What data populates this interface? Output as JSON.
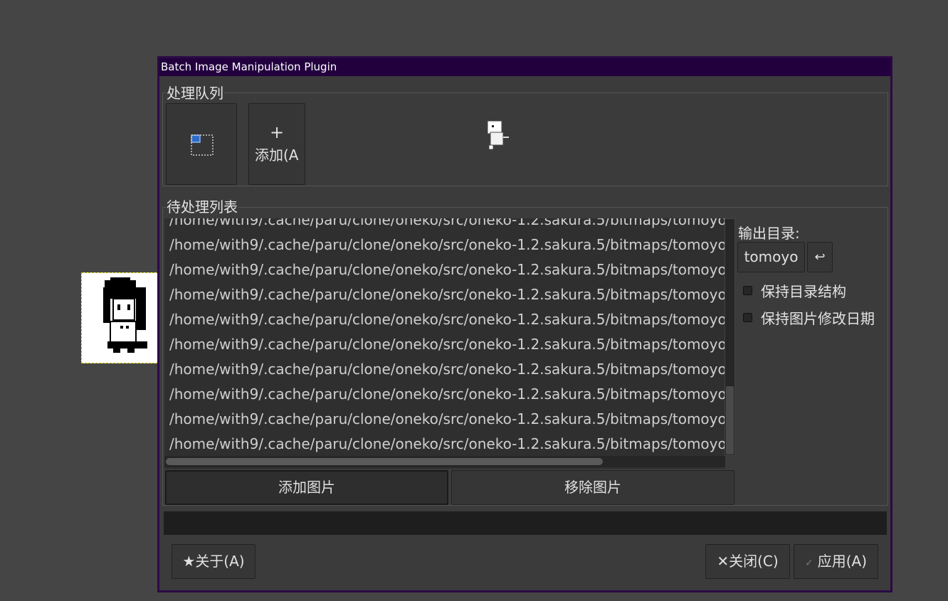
{
  "window_title": "Batch Image Manipulation Plugin",
  "queue": {
    "legend": "处理队列",
    "add_button_plus": "+",
    "add_button_label": "添加(A"
  },
  "files": {
    "legend": "待处理列表",
    "rows": [
      "/home/with9/.cache/paru/clone/oneko/src/oneko-1.2.sakura.5/bitmaps/tomoyo/ja",
      "/home/with9/.cache/paru/clone/oneko/src/oneko-1.2.sakura.5/bitmaps/tomoyo/d",
      "/home/with9/.cache/paru/clone/oneko/src/oneko-1.2.sakura.5/bitmaps/tomoyo/d",
      "/home/with9/.cache/paru/clone/oneko/src/oneko-1.2.sakura.5/bitmaps/tomoyo/d",
      "/home/with9/.cache/paru/clone/oneko/src/oneko-1.2.sakura.5/bitmaps/tomoyo/d",
      "/home/with9/.cache/paru/clone/oneko/src/oneko-1.2.sakura.5/bitmaps/tomoyo/d",
      "/home/with9/.cache/paru/clone/oneko/src/oneko-1.2.sakura.5/bitmaps/tomoyo/d",
      "/home/with9/.cache/paru/clone/oneko/src/oneko-1.2.sakura.5/bitmaps/tomoyo/d",
      "/home/with9/.cache/paru/clone/oneko/src/oneko-1.2.sakura.5/bitmaps/tomoyo/d",
      "/home/with9/.cache/paru/clone/oneko/src/oneko-1.2.sakura.5/bitmaps/tomoyo/av"
    ],
    "add_images_label": "添加图片",
    "remove_images_label": "移除图片"
  },
  "output": {
    "label": "输出目录:",
    "directory": "tomoyo",
    "reset_glyph": "↩",
    "keep_structure_label": "保持目录结构",
    "keep_structure_checked": false,
    "keep_dates_label": "保持图片修改日期",
    "keep_dates_checked": false
  },
  "footer": {
    "about_icon": "★",
    "about_label": "关于(A)",
    "close_icon": "✕",
    "close_label": "关闭(C)",
    "apply_icon": "✓",
    "apply_label": "应用(A)"
  }
}
